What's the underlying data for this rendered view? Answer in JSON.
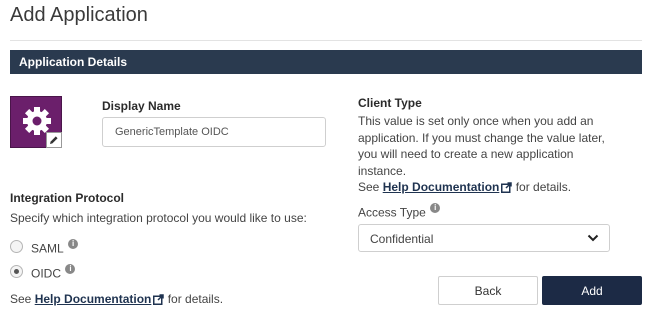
{
  "page": {
    "title": "Add Application"
  },
  "section": {
    "title": "Application Details"
  },
  "display_name": {
    "label": "Display Name",
    "value": "GenericTemplate OIDC"
  },
  "integration": {
    "label": "Integration Protocol",
    "description": "Specify which integration protocol you would like to use:",
    "options": [
      {
        "label": "SAML",
        "selected": false
      },
      {
        "label": "OIDC",
        "selected": true
      }
    ],
    "help_prefix": "See ",
    "help_link": "Help Documentation",
    "help_suffix": " for details."
  },
  "client_type": {
    "label": "Client Type",
    "description_lines": [
      "This value is set only once when you add an",
      "application. If you must change the value later,",
      "you will need to create a new application",
      "instance."
    ],
    "help_prefix": "See ",
    "help_link": "Help Documentation",
    "help_suffix": " for details."
  },
  "access_type": {
    "label": "Access Type",
    "selected": "Confidential"
  },
  "buttons": {
    "back": "Back",
    "add": "Add"
  },
  "colors": {
    "section_bar": "#2a3a4f",
    "primary_button": "#1c2a45",
    "app_icon_bg": "#6b1f6b"
  },
  "icons": {
    "app": "gear-icon",
    "edit": "pencil-icon",
    "info": "info-icon",
    "external": "external-link-icon",
    "dropdown": "chevron-down-icon"
  }
}
